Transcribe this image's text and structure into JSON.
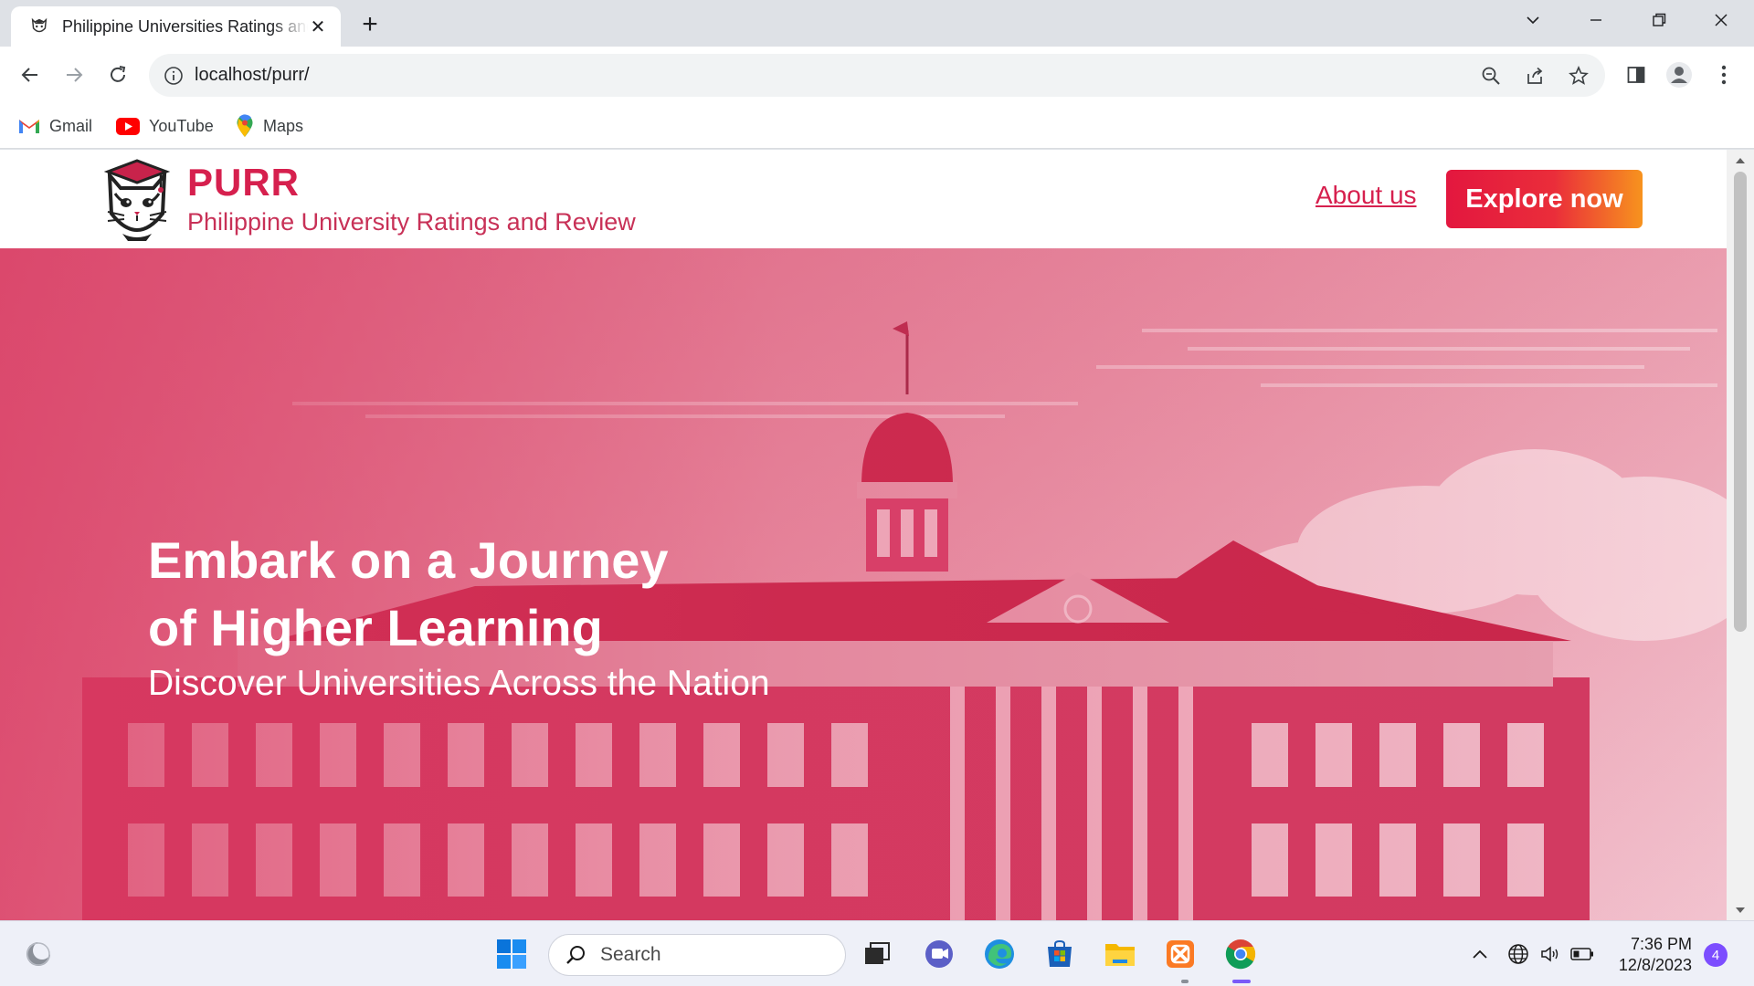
{
  "browser": {
    "tab_title": "Philippine Universities Ratings and Review",
    "url": "localhost/purr/",
    "bookmarks": [
      {
        "label": "Gmail",
        "icon": "gmail-icon"
      },
      {
        "label": "YouTube",
        "icon": "youtube-icon"
      },
      {
        "label": "Maps",
        "icon": "maps-icon"
      }
    ]
  },
  "site": {
    "brand": "PURR",
    "tagline": "Philippine University Ratings and Review",
    "nav": {
      "about": "About us",
      "cta": "Explore now"
    },
    "hero": {
      "title_line1": "Embark on a Journey",
      "title_line2": "of Higher Learning",
      "subtitle": "Discover Universities Across the Nation"
    }
  },
  "taskbar": {
    "search_label": "Search",
    "time": "7:36 PM",
    "date": "12/8/2023",
    "notifications": "4"
  },
  "colors": {
    "brand": "#d6204e",
    "cta_start": "#e3173f",
    "cta_end": "#f7931e"
  }
}
